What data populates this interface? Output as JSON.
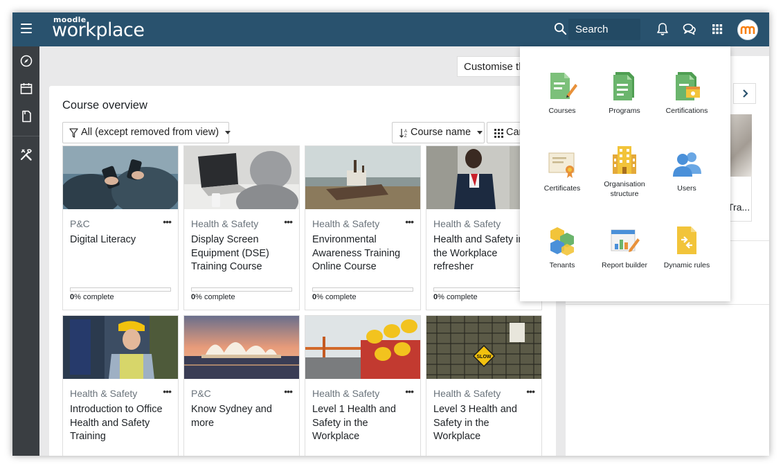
{
  "header": {
    "logo_top": "moodle",
    "logo_main": "workplace",
    "search_label": "Search"
  },
  "toolbar": {
    "customise_label": "Customise th"
  },
  "course_overview": {
    "title": "Course overview",
    "filter_label": "All (except removed from view)",
    "sort_label": "Course name",
    "view_label": "Car",
    "courses": [
      {
        "category": "P&C",
        "name": "Digital Literacy",
        "progress": 0,
        "pct": "0",
        "pct_suffix": "% complete"
      },
      {
        "category": "Health & Safety",
        "name": "Display Screen Equipment (DSE) Training Course",
        "progress": 0,
        "pct": "0",
        "pct_suffix": "% complete"
      },
      {
        "category": "Health & Safety",
        "name": "Environmental Awareness Training Online Course",
        "progress": 0,
        "pct": "0",
        "pct_suffix": "% complete"
      },
      {
        "category": "Health & Safety",
        "name": "Health and Safety in the Workplace refresher",
        "progress": 0,
        "pct": "0",
        "pct_suffix": "% complete"
      },
      {
        "category": "Health & Safety",
        "name": "Introduction to Office Health and Safety Training"
      },
      {
        "category": "P&C",
        "name": "Know Sydney and more"
      },
      {
        "category": "Health & Safety",
        "name": "Level 1 Health and Safety in the Workplace"
      },
      {
        "category": "Health & Safety",
        "name": "Level 3 Health and Safety in the Workplace"
      }
    ]
  },
  "right_panel": {
    "truncated_text": "Tra..."
  },
  "app_menu": {
    "items": [
      {
        "label": "Courses",
        "icon": "courses-icon"
      },
      {
        "label": "Programs",
        "icon": "programs-icon"
      },
      {
        "label": "Certifications",
        "icon": "certifications-icon"
      },
      {
        "label": "Certificates",
        "icon": "certificates-icon"
      },
      {
        "label": "Organisation structure",
        "icon": "organisation-icon"
      },
      {
        "label": "Users",
        "icon": "users-icon"
      },
      {
        "label": "Tenants",
        "icon": "tenants-icon"
      },
      {
        "label": "Report builder",
        "icon": "report-builder-icon"
      },
      {
        "label": "Dynamic rules",
        "icon": "dynamic-rules-icon"
      }
    ]
  },
  "colors": {
    "header": "#29526e",
    "sidebar": "#3a3e42",
    "accent_green": "#6bb56d",
    "accent_yellow": "#f2c43a",
    "accent_blue": "#4a90d9"
  }
}
